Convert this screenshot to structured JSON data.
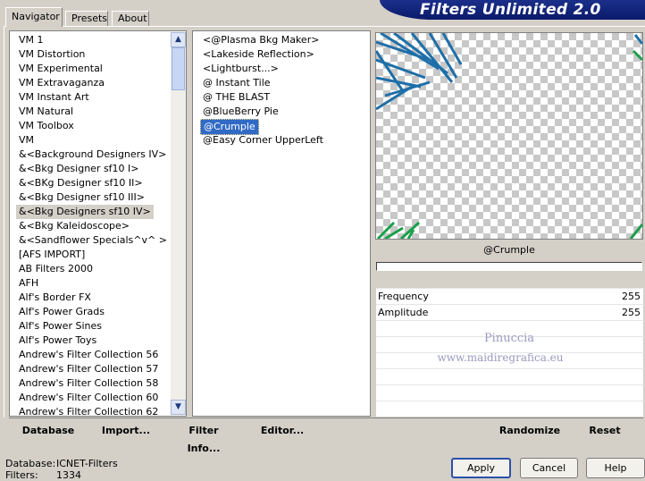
{
  "app": {
    "title": "Filters Unlimited 2.0"
  },
  "tabs": [
    {
      "label": "Navigator"
    },
    {
      "label": "Presets"
    },
    {
      "label": "About"
    }
  ],
  "categories": [
    "VM 1",
    "VM Distortion",
    "VM Experimental",
    "VM Extravaganza",
    "VM Instant Art",
    "VM Natural",
    "VM Toolbox",
    "VM",
    "&<Background Designers IV>",
    "&<Bkg Designer sf10 I>",
    "&<BKg Designer sf10 II>",
    "&<Bkg Designer sf10 III>",
    "&<Bkg Designers sf10 IV>",
    "&<Bkg Kaleidoscope>",
    "&<Sandflower Specials^v^ >",
    "[AFS IMPORT]",
    "AB Filters 2000",
    "AFH",
    "Alf's Border FX",
    "Alf's Power Grads",
    "Alf's Power Sines",
    "Alf's Power Toys",
    "Andrew's Filter Collection 56",
    "Andrew's Filter Collection 57",
    "Andrew's Filter Collection 58",
    "Andrew's Filter Collection 60",
    "Andrew's Filter Collection 62"
  ],
  "selected_category_index": 12,
  "filters": [
    "<@Plasma Bkg Maker>",
    "<Lakeside Reflection>",
    "<Lightburst...>",
    "@ Instant Tile",
    "@ THE BLAST",
    "@BlueBerry Pie",
    "@Crumple",
    "@Easy Corner UpperLeft"
  ],
  "selected_filter_index": 6,
  "preview": {
    "filter_name": "@Crumple"
  },
  "params": [
    {
      "label": "Frequency",
      "value": "255"
    },
    {
      "label": "Amplitude",
      "value": "255"
    }
  ],
  "watermark": {
    "line1": "Pinuccia",
    "line2": "www.maidiregrafica.eu"
  },
  "toolbar": {
    "database": "Database",
    "import": "Import...",
    "filter_info": "Filter Info...",
    "editor": "Editor...",
    "randomize": "Randomize",
    "reset": "Reset"
  },
  "status": {
    "database_label": "Database:",
    "database_value": "ICNET-Filters",
    "filters_label": "Filters:",
    "filters_value": "1334"
  },
  "buttons": {
    "apply": "Apply",
    "cancel": "Cancel",
    "help": "Help"
  },
  "colors": {
    "banner": "#0b1a6a",
    "selection": "#316ac5",
    "streak_blue": "#1e6fa8",
    "streak_green": "#1aa04a"
  }
}
